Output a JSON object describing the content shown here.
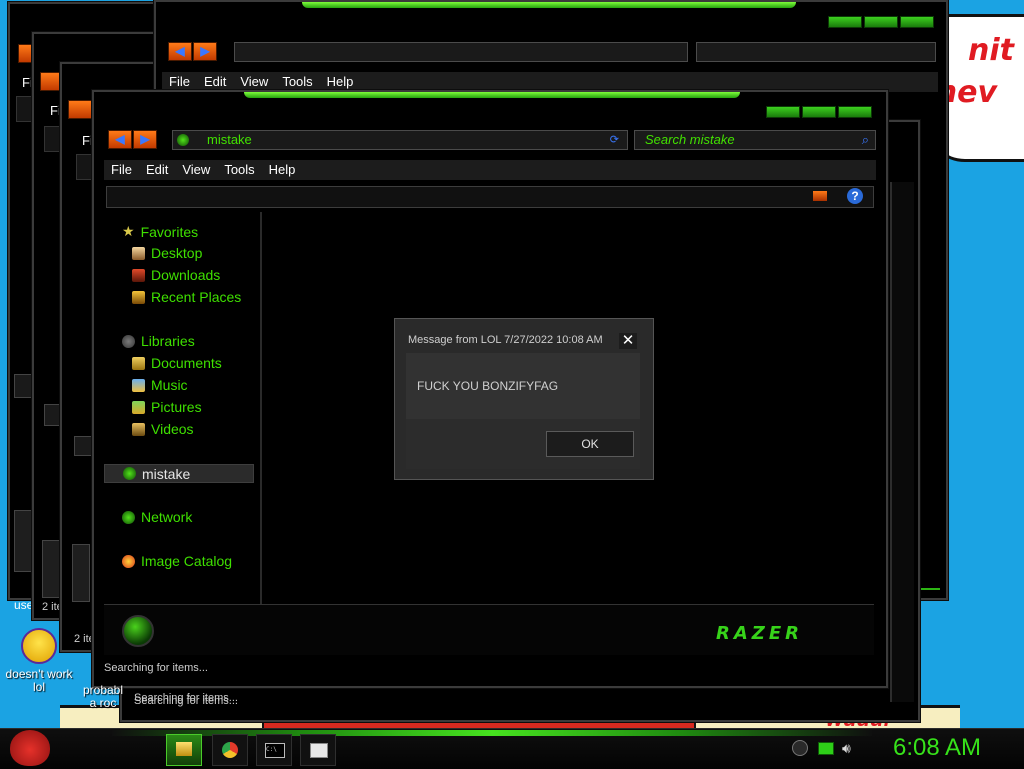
{
  "front_window": {
    "nav_back_glyph": "◀",
    "nav_forward_glyph": "▶",
    "address": "mistake",
    "search_placeholder": "Search mistake",
    "menu": [
      "File",
      "Edit",
      "View",
      "Tools",
      "Help"
    ],
    "help_glyph": "?",
    "nav": {
      "favorites": "Favorites",
      "desktop": "Desktop",
      "downloads": "Downloads",
      "recent_places": "Recent Places",
      "libraries": "Libraries",
      "documents": "Documents",
      "music": "Music",
      "pictures": "Pictures",
      "videos": "Videos",
      "current_folder": "mistake",
      "network": "Network",
      "image_catalog": "Image Catalog"
    },
    "brand_logo": "RAZER",
    "status": "Searching for items..."
  },
  "back_windows": {
    "menu": [
      "File",
      "Edit",
      "View",
      "Tools",
      "Help"
    ],
    "status": "Searching for items...",
    "item_count": "2 ite",
    "peek_menu_letter": "Fi",
    "peek_user_text": "use"
  },
  "dialog": {
    "title": "Message from LOL 7/27/2022 10:08 AM",
    "message": "FUCK YOU BONZIFYFAG",
    "ok_label": "OK",
    "close_glyph": "✕"
  },
  "desktop_icons": [
    {
      "label": "doesn't work lol",
      "icon": "yahoo-messenger-icon"
    },
    {
      "label": "probabl a roc",
      "icon": "document-icon"
    }
  ],
  "wallpaper_text": {
    "bubble_line1": "nit",
    "bubble_line2": "chev",
    "graffiti": "wuuuf"
  },
  "taskbar": {
    "start_icon": "angry-bird-icon",
    "apps": [
      "explorer-icon",
      "chrome-icon",
      "command-prompt-icon",
      "window-icon"
    ],
    "clock": "6:08 AM"
  },
  "colors": {
    "accent": "#3fe000",
    "window_bg": "#000000",
    "desktop_bg": "#1ba3e3"
  }
}
